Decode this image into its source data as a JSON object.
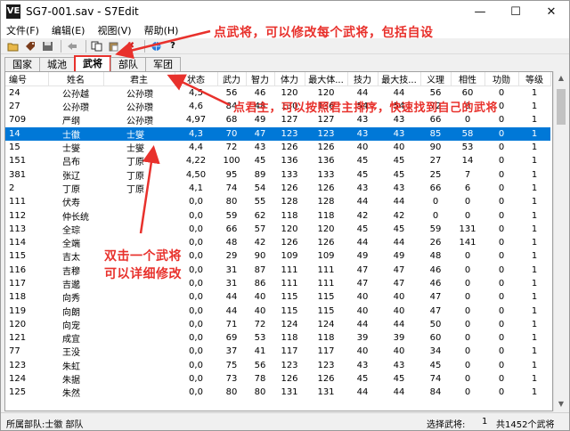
{
  "window": {
    "title": "SG7-001.sav - S7Edit",
    "app_icon": "VE",
    "controls": [
      "minimize-icon",
      "maximize-icon",
      "close-icon"
    ]
  },
  "menu": [
    "文件(F)",
    "编辑(E)",
    "视图(V)",
    "帮助(H)"
  ],
  "toolbar": [
    "open-folder-icon",
    "tag-icon",
    "save-icon",
    "back-arrow-icon",
    "copy-icon",
    "paste-icon",
    "delete-icon",
    "help-globe-icon",
    "help-question-icon"
  ],
  "tabs": [
    {
      "label": "国家",
      "active": false
    },
    {
      "label": "城池",
      "active": false
    },
    {
      "label": "武将",
      "active": true
    },
    {
      "label": "部队",
      "active": false
    },
    {
      "label": "军团",
      "active": false
    }
  ],
  "table": {
    "columns": [
      "编号",
      "姓名",
      "君主",
      "状态",
      "武力",
      "智力",
      "体力",
      "最大体...",
      "技力",
      "最大技...",
      "义理",
      "相性",
      "功勋",
      "等级"
    ],
    "rows": [
      [
        "24",
        "公孙越",
        "公孙瓒",
        "4,5",
        "56",
        "46",
        "120",
        "120",
        "44",
        "44",
        "56",
        "60",
        "0",
        "1"
      ],
      [
        "27",
        "公孙瓒",
        "公孙瓒",
        "4,6",
        "84",
        "48",
        "130",
        "136",
        "54",
        "54",
        "72",
        "0",
        "0",
        "1"
      ],
      [
        "709",
        "严纲",
        "公孙瓒",
        "4,97",
        "68",
        "49",
        "127",
        "127",
        "43",
        "43",
        "66",
        "0",
        "0",
        "1"
      ],
      [
        "14",
        "士徽",
        "士燮",
        "4,3",
        "70",
        "47",
        "123",
        "123",
        "43",
        "43",
        "85",
        "58",
        "0",
        "1"
      ],
      [
        "15",
        "士燮",
        "士燮",
        "4,4",
        "72",
        "43",
        "126",
        "126",
        "40",
        "40",
        "90",
        "53",
        "0",
        "1"
      ],
      [
        "151",
        "吕布",
        "丁原",
        "4,22",
        "100",
        "45",
        "136",
        "136",
        "45",
        "45",
        "27",
        "14",
        "0",
        "1"
      ],
      [
        "381",
        "张辽",
        "丁原",
        "4,50",
        "95",
        "89",
        "133",
        "133",
        "45",
        "45",
        "25",
        "7",
        "0",
        "1"
      ],
      [
        "2",
        "丁原",
        "丁原",
        "4,1",
        "74",
        "54",
        "126",
        "126",
        "43",
        "43",
        "66",
        "6",
        "0",
        "1"
      ],
      [
        "111",
        "伏寿",
        "",
        "0,0",
        "80",
        "55",
        "128",
        "128",
        "44",
        "44",
        "0",
        "0",
        "0",
        "1"
      ],
      [
        "112",
        "仲长统",
        "",
        "0,0",
        "59",
        "62",
        "118",
        "118",
        "42",
        "42",
        "0",
        "0",
        "0",
        "1"
      ],
      [
        "113",
        "全琮",
        "",
        "0,0",
        "66",
        "57",
        "120",
        "120",
        "45",
        "45",
        "59",
        "131",
        "0",
        "1"
      ],
      [
        "114",
        "全端",
        "",
        "0,0",
        "48",
        "42",
        "126",
        "126",
        "44",
        "44",
        "26",
        "141",
        "0",
        "1"
      ],
      [
        "115",
        "吉太",
        "",
        "0,0",
        "29",
        "90",
        "109",
        "109",
        "49",
        "49",
        "48",
        "0",
        "0",
        "1"
      ],
      [
        "116",
        "吉穆",
        "",
        "0,0",
        "31",
        "87",
        "111",
        "111",
        "47",
        "47",
        "46",
        "0",
        "0",
        "1"
      ],
      [
        "117",
        "吉邈",
        "",
        "0,0",
        "31",
        "86",
        "111",
        "111",
        "47",
        "47",
        "46",
        "0",
        "0",
        "1"
      ],
      [
        "118",
        "向秀",
        "",
        "0,0",
        "44",
        "40",
        "115",
        "115",
        "40",
        "40",
        "47",
        "0",
        "0",
        "1"
      ],
      [
        "119",
        "向朗",
        "",
        "0,0",
        "44",
        "40",
        "115",
        "115",
        "40",
        "40",
        "47",
        "0",
        "0",
        "1"
      ],
      [
        "120",
        "向宠",
        "",
        "0,0",
        "71",
        "72",
        "124",
        "124",
        "44",
        "44",
        "50",
        "0",
        "0",
        "1"
      ],
      [
        "121",
        "成宜",
        "",
        "0,0",
        "69",
        "53",
        "118",
        "118",
        "39",
        "39",
        "60",
        "0",
        "0",
        "1"
      ],
      [
        "77",
        "王没",
        "",
        "0,0",
        "37",
        "41",
        "117",
        "117",
        "40",
        "40",
        "34",
        "0",
        "0",
        "1"
      ],
      [
        "123",
        "朱虹",
        "",
        "0,0",
        "75",
        "56",
        "123",
        "123",
        "43",
        "43",
        "45",
        "0",
        "0",
        "1"
      ],
      [
        "124",
        "朱据",
        "",
        "0,0",
        "73",
        "78",
        "126",
        "126",
        "45",
        "45",
        "74",
        "0",
        "0",
        "1"
      ],
      [
        "125",
        "朱然",
        "",
        "0,0",
        "80",
        "80",
        "131",
        "131",
        "44",
        "44",
        "84",
        "0",
        "0",
        "1"
      ]
    ],
    "selected_index": 3
  },
  "status": {
    "left": "所属部队:士徽 部队",
    "mid": "选择武将:",
    "count": "1",
    "total": "共1452个武将"
  },
  "annotations": {
    "top": "点武将，可以修改每个武将，包括自设",
    "middle": "点君主，可以按照君主排序，快速找到自己的武将",
    "bottom_line1": "双击一个武将",
    "bottom_line2": "可以详细修改"
  },
  "colors": {
    "annotation": "#e8312c",
    "selection": "#0078d7"
  }
}
